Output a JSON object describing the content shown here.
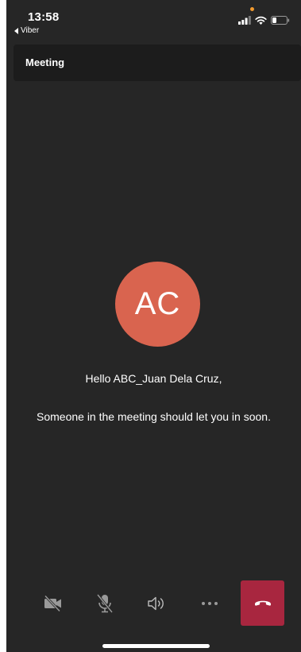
{
  "status_bar": {
    "time": "13:58",
    "back_app": "Viber",
    "icons": [
      "signal-icon",
      "wifi-icon",
      "battery-icon"
    ]
  },
  "header": {
    "title": "Meeting"
  },
  "participant": {
    "initials": "AC",
    "avatar_color": "#d9644f"
  },
  "messages": {
    "greeting": "Hello ABC_Juan Dela Cruz,",
    "waiting": "Someone in the meeting should let you in soon."
  },
  "controls": {
    "icons": [
      "camera-off-icon",
      "mic-off-icon",
      "speaker-icon",
      "more-icon",
      "hang-up-icon"
    ],
    "end_call_color": "#a8263f"
  },
  "colors": {
    "background": "#262626",
    "header_background": "#1c1c1c"
  }
}
